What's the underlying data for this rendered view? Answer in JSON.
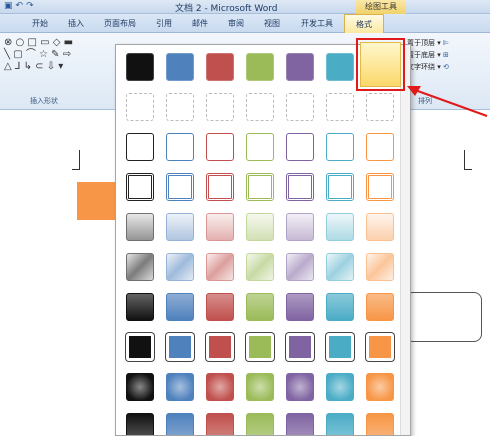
{
  "window": {
    "title": "文档 2 - Microsoft Word",
    "tools_tab": "绘图工具"
  },
  "tabs": [
    "开始",
    "插入",
    "页面布局",
    "引用",
    "邮件",
    "审阅",
    "视图",
    "开发工具",
    "格式"
  ],
  "active_tab": "格式",
  "ribbon": {
    "insert_shapes_label": "插入形状",
    "arrange_label": "排列",
    "arrange_items": [
      "置于顶层",
      "置于底层",
      "文字环绕"
    ]
  },
  "colors": {
    "black": "#111111",
    "blue": "#4f81bd",
    "red": "#c0504d",
    "green": "#9bbb59",
    "purple": "#8064a2",
    "aqua": "#4bacc6",
    "orange": "#f79646"
  },
  "gallery": {
    "rows": [
      "filled",
      "dashed-outline",
      "outline-thin",
      "outline-thick",
      "light-gradient",
      "diagonal-gradient",
      "intense-gradient",
      "bevel-dark",
      "radial-dark",
      "shaded"
    ],
    "selected": "orange-filled"
  }
}
